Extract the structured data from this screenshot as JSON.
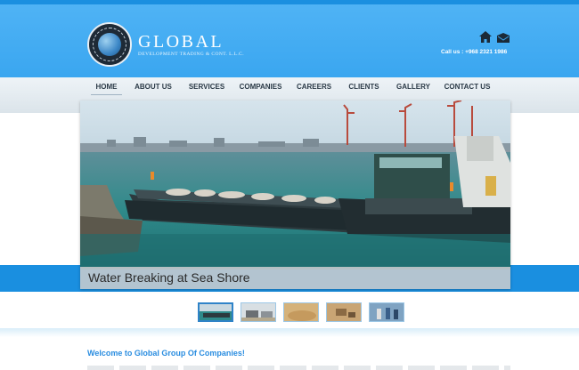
{
  "brand": {
    "title": "GLOBAL",
    "subtitle": "DEVELOPMENT TRADING & CONT. L.L.C.",
    "emblem_ring_text": "GLOBAL DEVELOPMENT TRADING & CONT. LLC"
  },
  "header": {
    "call_text": "Call us : +968 2321 1986",
    "icons": [
      "home-icon",
      "mail-icon"
    ]
  },
  "nav": {
    "items": [
      {
        "label": "HOME",
        "active": true
      },
      {
        "label": "ABOUT US"
      },
      {
        "label": "SERVICES"
      },
      {
        "label": "COMPANIES"
      },
      {
        "label": "CAREERS"
      },
      {
        "label": "CLIENTS"
      },
      {
        "label": "GALLERY"
      },
      {
        "label": "CONTACT US"
      }
    ]
  },
  "slider": {
    "caption": "Water Breaking at Sea Shore",
    "thumbnails": [
      "barge",
      "trucks",
      "sand",
      "excavation",
      "workers"
    ],
    "active_thumbnail": 0
  },
  "content": {
    "welcome": "Welcome to Global Group Of Companies!"
  },
  "colors": {
    "header_blue": "#3aa6f0",
    "band_blue": "#1a8fe0",
    "nav_text": "#2b3a47",
    "welcome_blue": "#2a8de0"
  }
}
